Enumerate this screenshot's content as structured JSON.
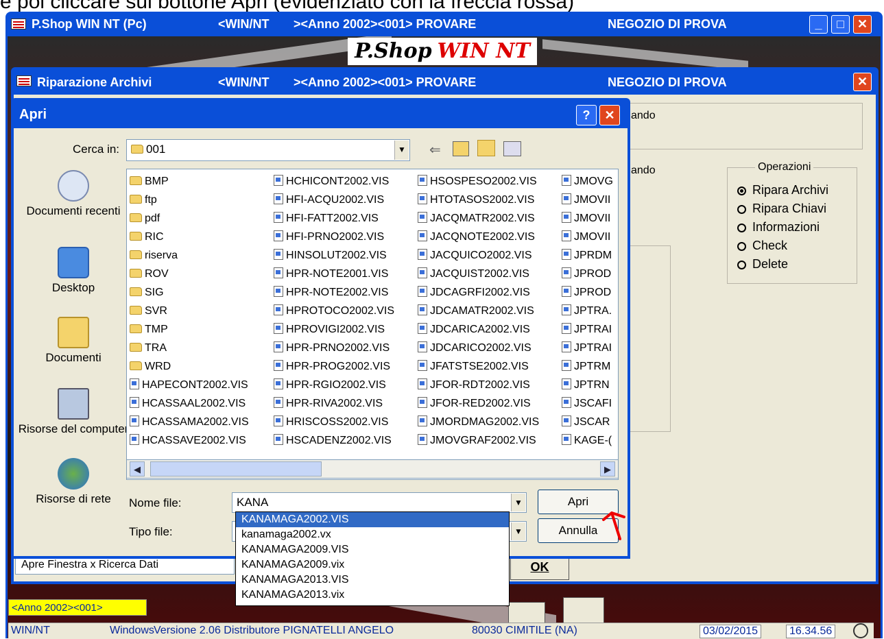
{
  "caption": "e poi cliccare sul bottone Apri (evidenziato con la freccia rossa)",
  "main_window": {
    "title": "P.Shop WIN NT (Pc)",
    "env": "<WIN/NT",
    "year": "><Anno 2002><001> PROVARE",
    "shop": "NEGOZIO DI PROVA",
    "logo_a": "P.Shop",
    "logo_b": "WIN NT"
  },
  "rip_window": {
    "title": "Riparazione Archivi",
    "env": "<WIN/NT",
    "year": "><Anno 2002><001> PROVARE",
    "shop": "NEGOZIO DI PROVA",
    "label1": "ando",
    "label2": "ando",
    "operazioni_title": "Operazioni",
    "operazioni": [
      "Ripara Archivi",
      "Ripara Chiavi",
      "Informazioni",
      "Check",
      "Delete"
    ],
    "status": "Apre Finestra x Ricerca Dati",
    "ok_label": "OK"
  },
  "dialog": {
    "title": "Apri",
    "help": "?",
    "lookin_label": "Cerca in:",
    "lookin_value": "001",
    "places": [
      "Documenti recenti",
      "Desktop",
      "Documenti",
      "Risorse del computer",
      "Risorse di rete"
    ],
    "filename_label": "Nome file:",
    "filename_value": "KANA",
    "filetype_label": "Tipo file:",
    "open_label": "Apri",
    "cancel_label": "Annulla",
    "columns": [
      [
        "BMP",
        "ftp",
        "pdf",
        "RIC",
        "riserva",
        "ROV",
        "SIG",
        "SVR",
        "TMP",
        "TRA",
        "WRD",
        "HAPECONT2002.VIS",
        "HCASSAAL2002.VIS",
        "HCASSAMA2002.VIS",
        "HCASSAVE2002.VIS"
      ],
      [
        "HCHICONT2002.VIS",
        "HFI-ACQU2002.VIS",
        "HFI-FATT2002.VIS",
        "HFI-PRNO2002.VIS",
        "HINSOLUT2002.VIS",
        "HPR-NOTE2001.VIS",
        "HPR-NOTE2002.VIS",
        "HPROTOCO2002.VIS",
        "HPROVIGI2002.VIS",
        "HPR-PRNO2002.VIS",
        "HPR-PROG2002.VIS",
        "HPR-RGIO2002.VIS",
        "HPR-RIVA2002.VIS",
        "HRISCOSS2002.VIS",
        "HSCADENZ2002.VIS"
      ],
      [
        "HSOSPESO2002.VIS",
        "HTOTASOS2002.VIS",
        "JACQMATR2002.VIS",
        "JACQNOTE2002.VIS",
        "JACQUICO2002.VIS",
        "JACQUIST2002.VIS",
        "JDCAGRFI2002.VIS",
        "JDCAMATR2002.VIS",
        "JDCARICA2002.VIS",
        "JDCARICO2002.VIS",
        "JFATSTSE2002.VIS",
        "JFOR-RDT2002.VIS",
        "JFOR-RED2002.VIS",
        "JMORDMAG2002.VIS",
        "JMOVGRAF2002.VIS"
      ],
      [
        "JMOVG",
        "JMOVII",
        "JMOVII",
        "JMOVII",
        "JPRDM",
        "JPROD",
        "JPROD",
        "JPTRA.",
        "JPTRAI",
        "JPTRAI",
        "JPTRM",
        "JPTRN",
        "JSCAFI",
        "JSCAR",
        "KAGE-("
      ]
    ],
    "autocomplete": [
      "KANAMAGA2002.VIS",
      "kanamaga2002.vx",
      "KANAMAGA2009.VIS",
      "KANAMAGA2009.vix",
      "KANAMAGA2013.VIS",
      "KANAMAGA2013.vix"
    ]
  },
  "statusbar": {
    "anno": "<Anno 2002><001>",
    "winnt": "WIN/NT",
    "windows": "Windows",
    "versione": "Versione 2.06 Distributore PIGNATELLI ANGELO",
    "city": "80030 CIMITILE (NA)",
    "date": "03/02/2015",
    "time": "16.34.56"
  }
}
